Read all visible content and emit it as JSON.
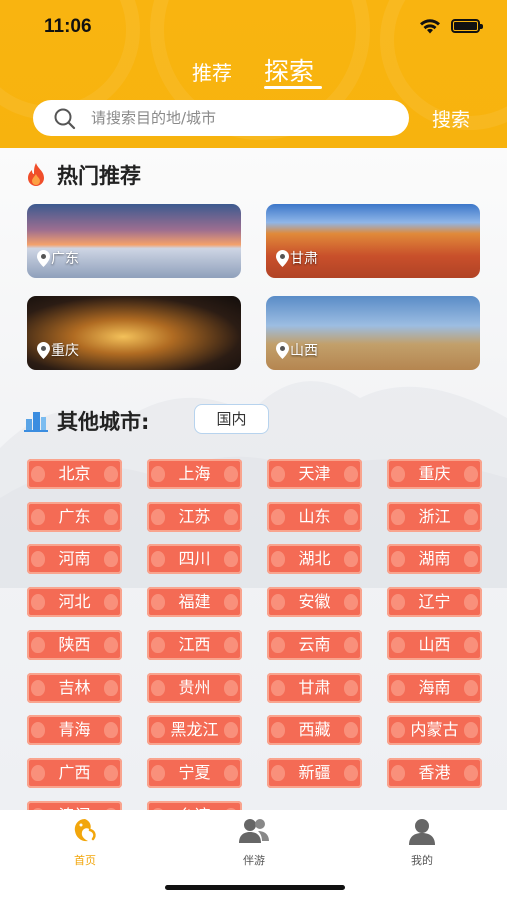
{
  "status_bar": {
    "time": "11:06"
  },
  "top_tabs": [
    {
      "label": "推荐",
      "active": false
    },
    {
      "label": "探索",
      "active": true
    }
  ],
  "search": {
    "placeholder": "请搜索目的地/城市",
    "button_label": "搜索"
  },
  "hot": {
    "title": "热门推荐",
    "cards": [
      {
        "label": "广东"
      },
      {
        "label": "甘肃"
      },
      {
        "label": "重庆"
      },
      {
        "label": "山西"
      }
    ]
  },
  "other": {
    "title": "其他城市:",
    "region_label": "国内",
    "cities": [
      "北京",
      "上海",
      "天津",
      "重庆",
      "广东",
      "江苏",
      "山东",
      "浙江",
      "河南",
      "四川",
      "湖北",
      "湖南",
      "河北",
      "福建",
      "安徽",
      "辽宁",
      "陕西",
      "江西",
      "云南",
      "山西",
      "吉林",
      "贵州",
      "甘肃",
      "海南",
      "青海",
      "黑龙江",
      "西藏",
      "内蒙古",
      "广西",
      "宁夏",
      "新疆",
      "香港",
      "澳门",
      "台湾"
    ]
  },
  "tabbar": [
    {
      "label": "首页",
      "icon": "home-dragon-icon",
      "active": true
    },
    {
      "label": "伴游",
      "icon": "companions-icon",
      "active": false
    },
    {
      "label": "我的",
      "icon": "profile-icon",
      "active": false
    }
  ],
  "colors": {
    "header": "#f9b410",
    "chip": "#f46b55",
    "active_tab": "#f2a60c"
  }
}
